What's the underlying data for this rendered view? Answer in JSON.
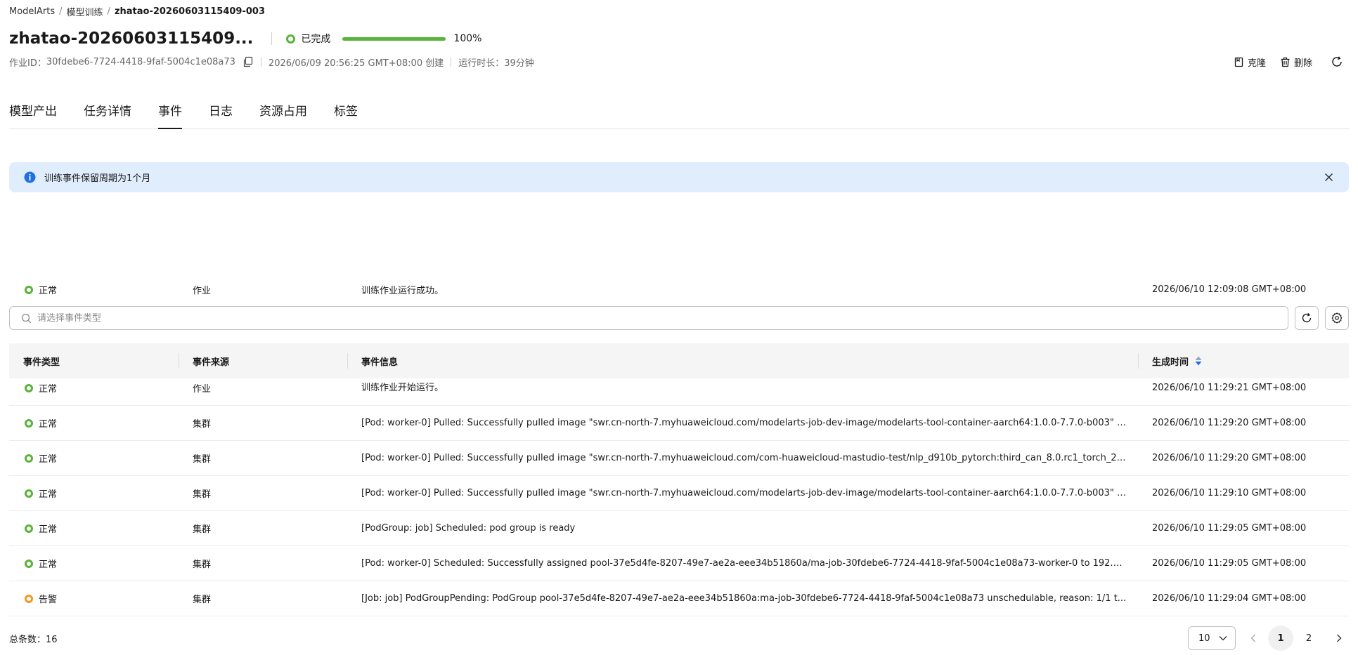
{
  "breadcrumb": {
    "root": "ModelArts",
    "sep1": "/",
    "section": "模型训练",
    "sep2": "/",
    "current": "zhatao-20260603115409-003"
  },
  "job": {
    "title": "zhatao-20260603115409...",
    "status": "已完成",
    "status_color": "#5ab33a",
    "progress_percent": 100,
    "progress_label": "100%"
  },
  "meta": {
    "id_label": "作业ID：",
    "id_value": "30fdebe6-7724-4418-9faf-5004c1e08a73",
    "created": "2026/06/09 20:56:25 GMT+08:00 创建",
    "duration": "运行时长：39分钟"
  },
  "actions": {
    "clone": "克隆",
    "delete": "删除"
  },
  "tabs": [
    {
      "label": "模型产出",
      "active": false
    },
    {
      "label": "任务详情",
      "active": false
    },
    {
      "label": "事件",
      "active": true
    },
    {
      "label": "日志",
      "active": false
    },
    {
      "label": "资源占用",
      "active": false
    },
    {
      "label": "标签",
      "active": false
    }
  ],
  "alert": {
    "text": "训练事件保留周期为1个月"
  },
  "sticky_row": {
    "level": "正常",
    "source": "作业",
    "message": "训练作业运行成功。",
    "time": "2026/06/10 12:09:08 GMT+08:00"
  },
  "search": {
    "placeholder": "请选择事件类型"
  },
  "table": {
    "headers": {
      "type": "事件类型",
      "source": "事件来源",
      "message": "事件信息",
      "time": "生成时间"
    },
    "rows": [
      {
        "level": "正常",
        "kind": "normal",
        "source": "作业",
        "message": "训练作业开始运行。",
        "time": "2026/06/10 11:29:21 GMT+08:00"
      },
      {
        "level": "正常",
        "kind": "normal",
        "source": "集群",
        "message": "[Pod: worker-0] Pulled: Successfully pulled image \"swr.cn-north-7.myhuaweicloud.com/modelarts-job-dev-image/modelarts-tool-container-aarch64:1.0.0-7.7.0-b003\" in ...",
        "time": "2026/06/10 11:29:20 GMT+08:00"
      },
      {
        "level": "正常",
        "kind": "normal",
        "source": "集群",
        "message": "[Pod: worker-0] Pulled: Successfully pulled image \"swr.cn-north-7.myhuaweicloud.com/com-huaweicloud-mastudio-test/nlp_d910b_pytorch:third_can_8.0.rc1_torch_2....",
        "time": "2026/06/10 11:29:20 GMT+08:00"
      },
      {
        "level": "正常",
        "kind": "normal",
        "source": "集群",
        "message": "[Pod: worker-0] Pulled: Successfully pulled image \"swr.cn-north-7.myhuaweicloud.com/modelarts-job-dev-image/modelarts-tool-container-aarch64:1.0.0-7.7.0-b003\" in ...",
        "time": "2026/06/10 11:29:10 GMT+08:00"
      },
      {
        "level": "正常",
        "kind": "normal",
        "source": "集群",
        "message": "[PodGroup: job] Scheduled: pod group is ready",
        "time": "2026/06/10 11:29:05 GMT+08:00"
      },
      {
        "level": "正常",
        "kind": "normal",
        "source": "集群",
        "message": "[Pod: worker-0] Scheduled: Successfully assigned pool-37e5d4fe-8207-49e7-ae2a-eee34b51860a/ma-job-30fdebe6-7724-4418-9faf-5004c1e08a73-worker-0 to 192.1...",
        "time": "2026/06/10 11:29:05 GMT+08:00"
      },
      {
        "level": "告警",
        "kind": "warn",
        "source": "集群",
        "message": "[Job: job] PodGroupPending: PodGroup pool-37e5d4fe-8207-49e7-ae2a-eee34b51860a:ma-job-30fdebe6-7724-4418-9faf-5004c1e08a73 unschedulable, reason: 1/1 t...",
        "time": "2026/06/10 11:29:04 GMT+08:00"
      }
    ]
  },
  "pagination": {
    "total_label": "总条数：",
    "total": "16",
    "page_size": "10",
    "pages": [
      "1",
      "2"
    ],
    "current": "1"
  }
}
